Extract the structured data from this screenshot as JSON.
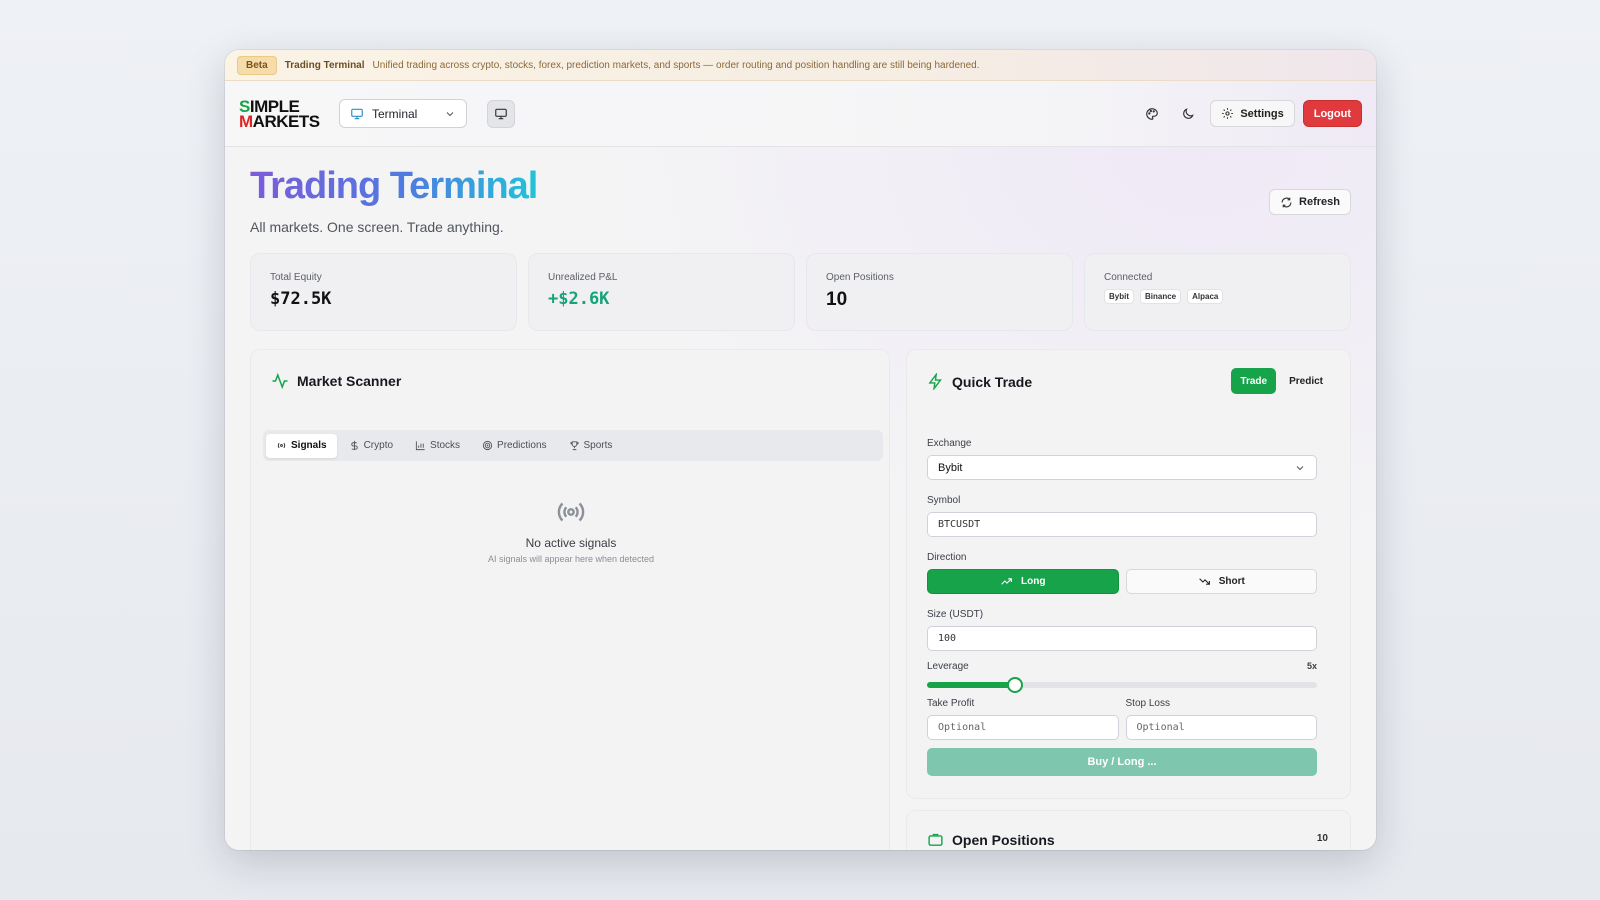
{
  "banner": {
    "badge": "Beta",
    "title": "Trading Terminal",
    "message": "Unified trading across crypto, stocks, forex, prediction markets, and sports — order routing and position handling are still being hardened."
  },
  "header": {
    "logo_line1_s": "S",
    "logo_line1_rest": "IMPLE",
    "logo_line2_m": "M",
    "logo_line2_rest": "ARKETS",
    "view_select": "Terminal",
    "settings_label": "Settings",
    "logout_label": "Logout"
  },
  "page": {
    "title": "Trading Terminal",
    "subtitle": "All markets. One screen. Trade anything.",
    "refresh_label": "Refresh"
  },
  "stats": [
    {
      "label": "Total Equity",
      "value": "$72.5K"
    },
    {
      "label": "Unrealized P&L",
      "value": "+$2.6K"
    },
    {
      "label": "Open Positions",
      "value": "10"
    },
    {
      "label": "Connected",
      "exchanges": [
        "Bybit",
        "Binance",
        "Alpaca"
      ]
    }
  ],
  "scanner": {
    "title": "Market Scanner",
    "tabs": [
      "Signals",
      "Crypto",
      "Stocks",
      "Predictions",
      "Sports"
    ],
    "active_tab": "Signals",
    "empty_title": "No active signals",
    "empty_subtitle": "AI signals will appear here when detected"
  },
  "quick_trade": {
    "title": "Quick Trade",
    "modes": [
      "Trade",
      "Predict"
    ],
    "active_mode": "Trade",
    "exchange_label": "Exchange",
    "exchange_value": "Bybit",
    "symbol_label": "Symbol",
    "symbol_value": "BTCUSDT",
    "direction_label": "Direction",
    "long_label": "Long",
    "short_label": "Short",
    "size_label": "Size (USDT)",
    "size_value": "100",
    "leverage_label": "Leverage",
    "leverage_value": "5x",
    "leverage_fraction": 0.225,
    "tp_label": "Take Profit",
    "tp_placeholder": "Optional",
    "sl_label": "Stop Loss",
    "sl_placeholder": "Optional",
    "submit_label": "Buy / Long ..."
  },
  "open_positions": {
    "title": "Open Positions",
    "count": "10"
  },
  "colors": {
    "accent_green": "#16a34a",
    "logout_red": "#e03a3e",
    "pnl_green": "#16a37a"
  }
}
